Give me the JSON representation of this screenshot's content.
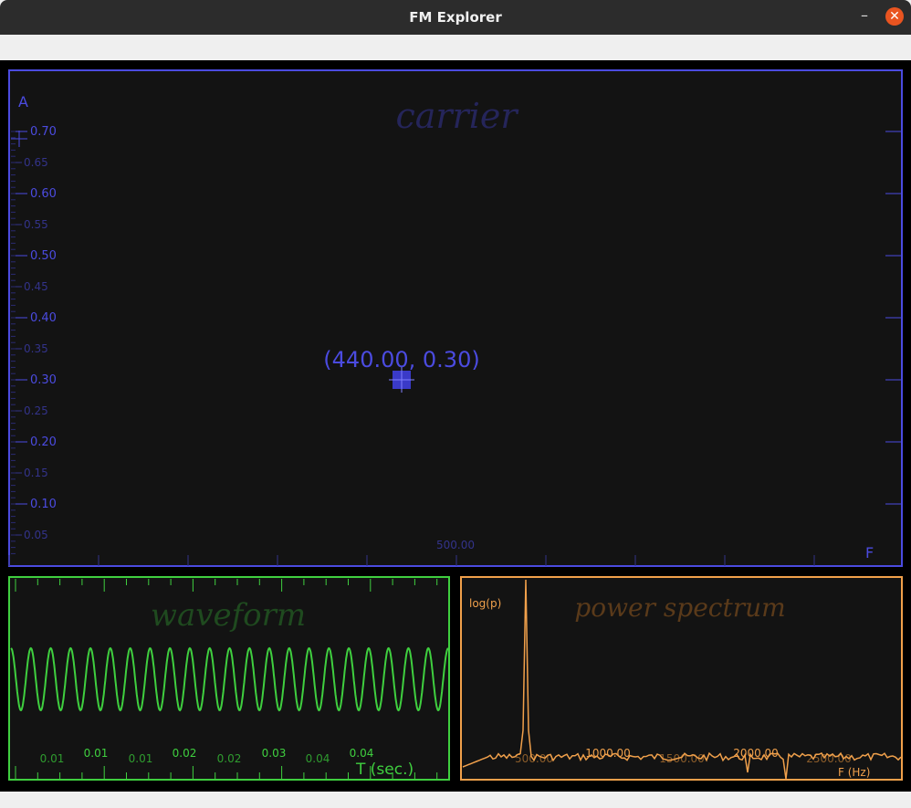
{
  "window": {
    "title": "FM Explorer",
    "min_icon": "minimize-icon",
    "close_icon": "close-icon"
  },
  "colors": {
    "carrier": "#4b4be0",
    "waveform": "#3fcf3f",
    "spectrum": "#f0a04b",
    "background": "#131313"
  },
  "carrier": {
    "title": "carrier",
    "y_axis_label": "A",
    "x_axis_label": "F",
    "y_ticks_major": [
      "0.70",
      "0.60",
      "0.50",
      "0.40",
      "0.30",
      "0.20",
      "0.10"
    ],
    "y_ticks_minor": [
      "0.65",
      "0.55",
      "0.45",
      "0.35",
      "0.25",
      "0.15",
      "0.05"
    ],
    "x_tick": "500.00",
    "point_label": "(440.00, 0.30)",
    "point": {
      "f": 440.0,
      "a": 0.3
    }
  },
  "waveform": {
    "title": "waveform",
    "x_axis_label": "T (sec.)",
    "ticks_major": [
      "0.01",
      "0.02",
      "0.03",
      "0.04"
    ],
    "ticks_minor": [
      "0.01",
      "0.01",
      "0.02",
      "0.04"
    ],
    "cycles": 22
  },
  "spectrum": {
    "title": "power spectrum",
    "y_axis_label": "log(p)",
    "x_axis_label": "F (Hz)",
    "ticks_major": [
      "1000.00",
      "2000.00"
    ],
    "ticks_minor": [
      "500.00",
      "1500.00",
      "2500.00"
    ],
    "peak_hz": 440
  }
}
